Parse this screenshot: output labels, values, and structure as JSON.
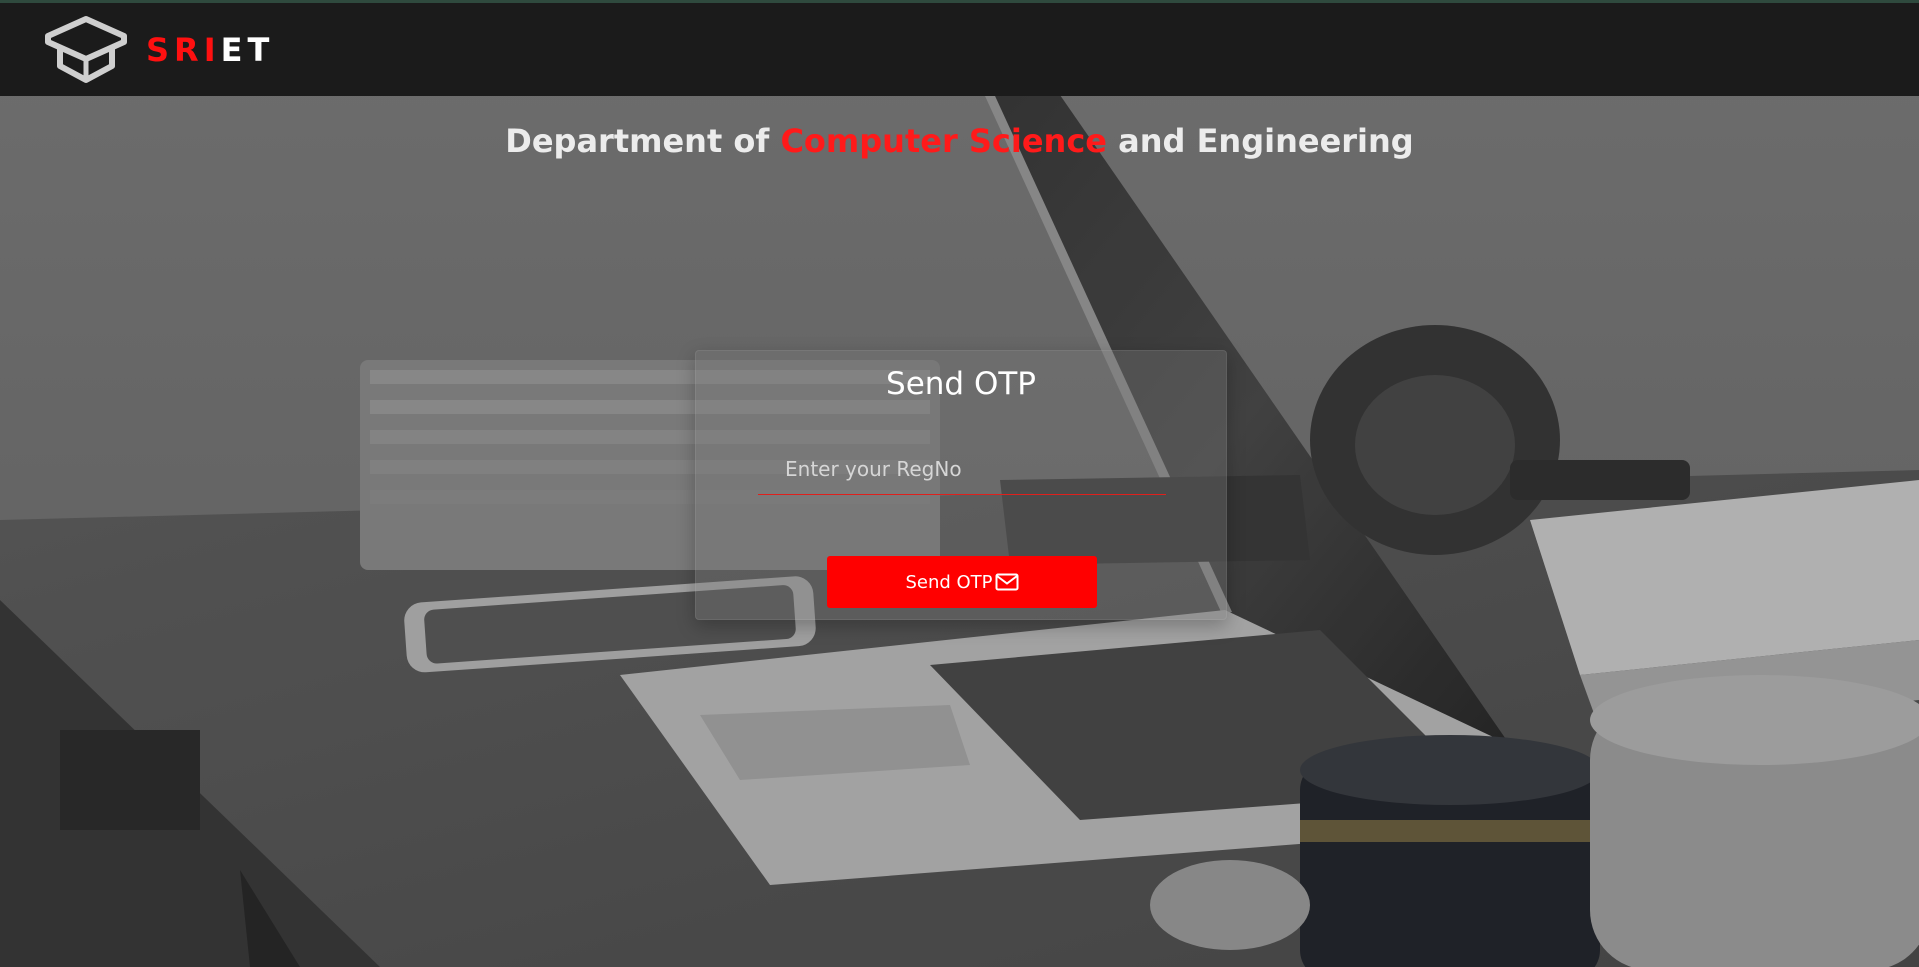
{
  "header": {
    "brand_part1": "SRI",
    "brand_part2": "ET"
  },
  "heading": {
    "prefix": "Department of ",
    "highlight": "Computer Science",
    "suffix": " and Engineering"
  },
  "form": {
    "title": "Send OTP",
    "regno_placeholder": "Enter your RegNo",
    "regno_value": "",
    "submit_label": "Send OTP"
  },
  "icons": {
    "logo": "graduation-cap-cube-icon",
    "submit": "envelope-icon"
  },
  "colors": {
    "accent": "#ff0000",
    "navbar": "#1b1b1b",
    "heading_text": "#ececec"
  }
}
